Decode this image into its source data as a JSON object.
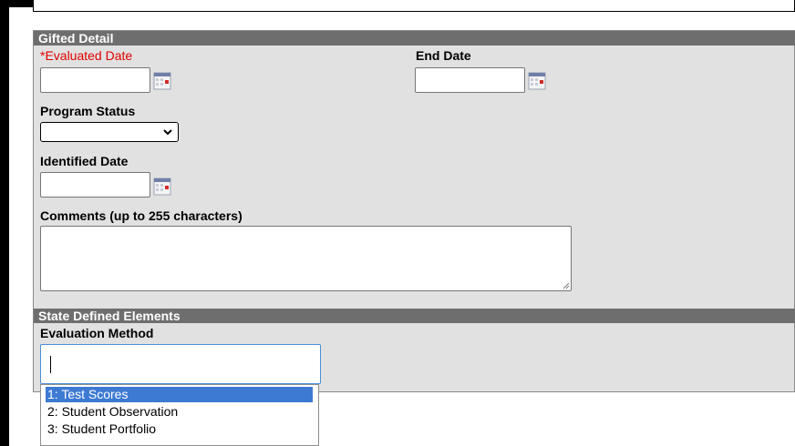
{
  "gifted_detail": {
    "header": "Gifted Detail",
    "evaluated_date_label": "*Evaluated Date",
    "end_date_label": "End Date",
    "program_status_label": "Program Status",
    "identified_date_label": "Identified Date",
    "comments_label": "Comments (up to 255 characters)"
  },
  "state_defined": {
    "header": "State Defined Elements",
    "evaluation_method_label": "Evaluation Method",
    "options": [
      "1: Test Scores",
      "2: Student Observation",
      "3: Student Portfolio"
    ],
    "selected_index": 0
  },
  "colors": {
    "header_bg": "#6e6e6e",
    "panel_bg": "#e1e1e1",
    "required_label": "#e00000",
    "selected_option": "#3d7ad3"
  },
  "icons": {
    "calendar": "calendar-icon",
    "dropdown": "chevron-down-icon"
  }
}
